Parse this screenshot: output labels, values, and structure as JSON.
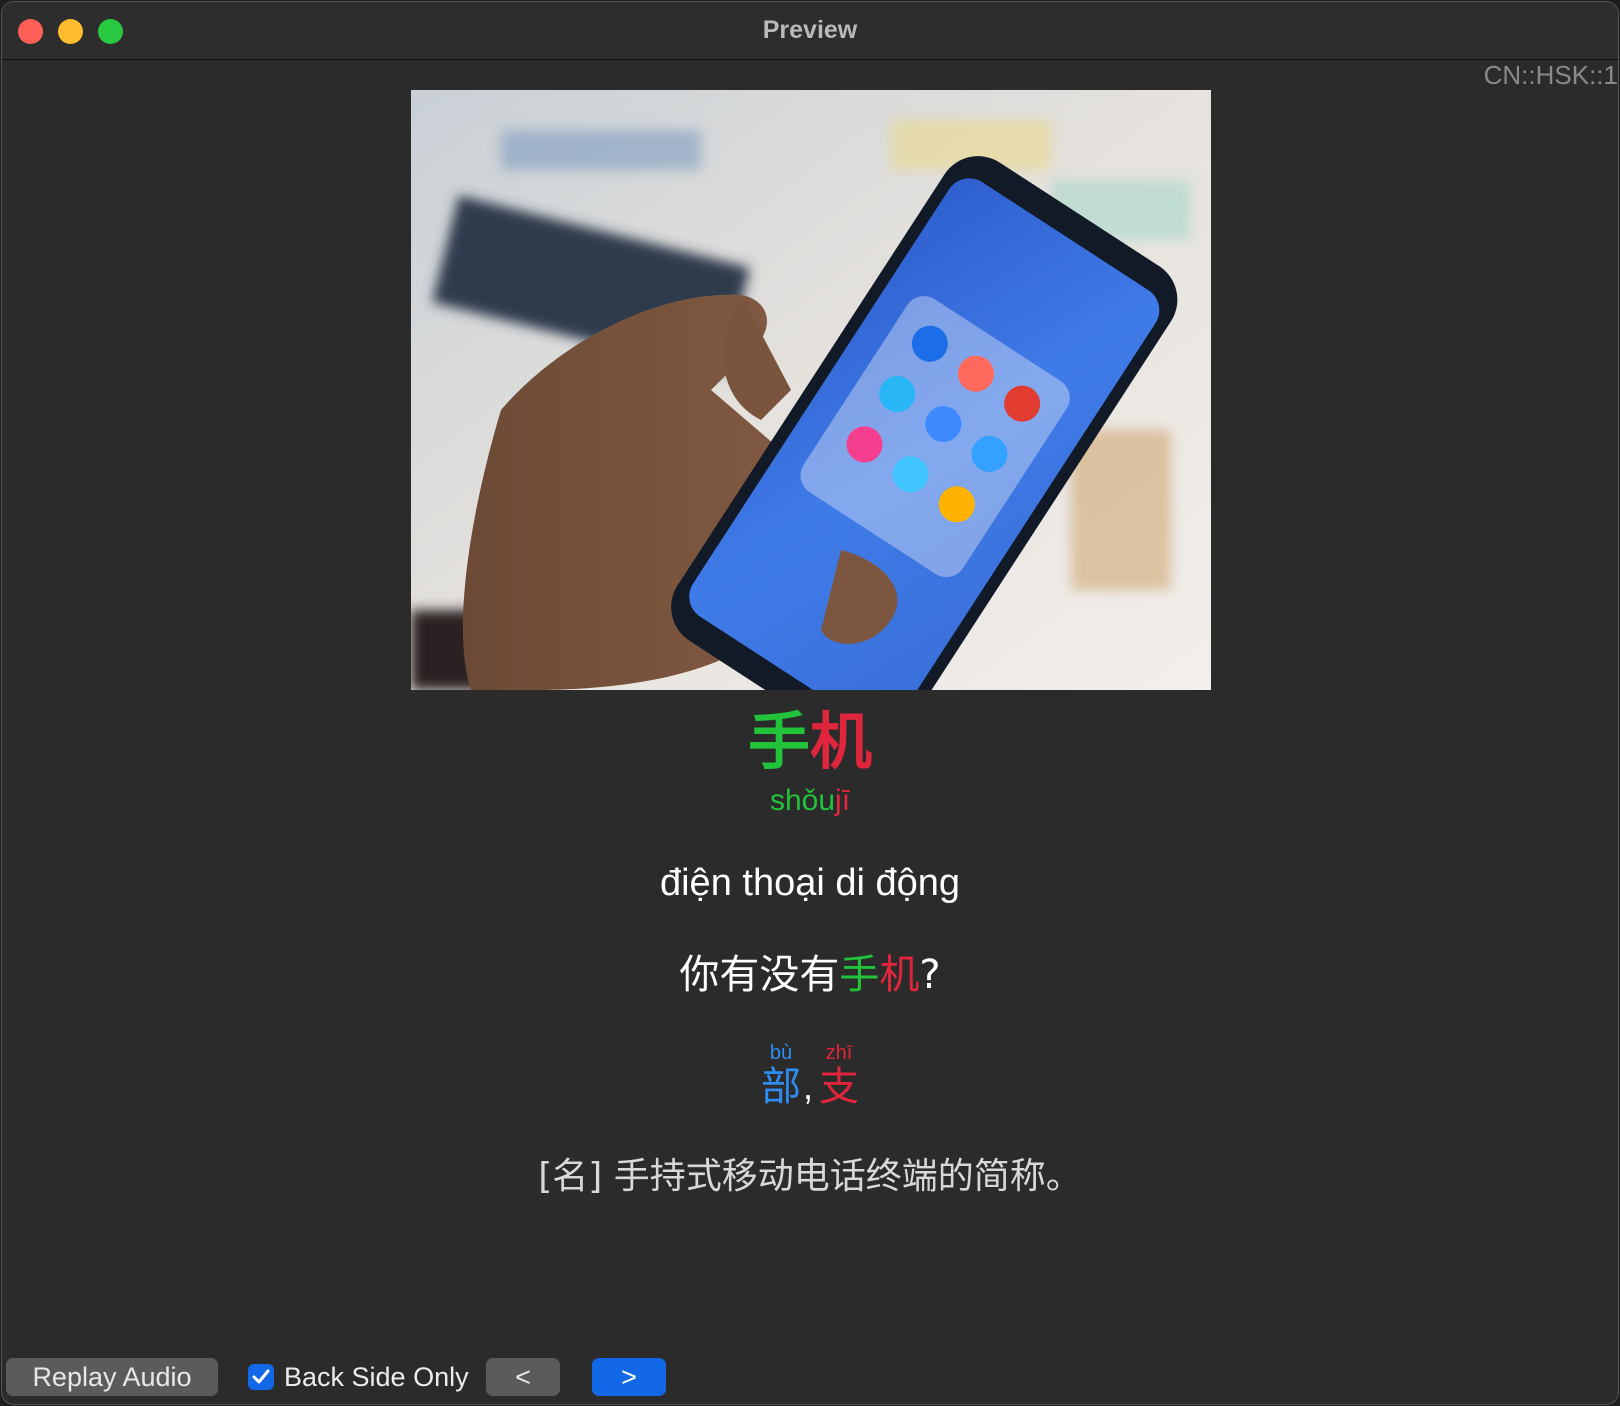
{
  "window": {
    "title": "Preview",
    "deck_tag": "CN::HSK::1"
  },
  "card": {
    "image_alt": "hand holding smartphone",
    "hanzi": [
      {
        "char": "手",
        "tone_color": "#22c23a"
      },
      {
        "char": "机",
        "tone_color": "#e0263c"
      }
    ],
    "pinyin": [
      {
        "syllable": "shǒu",
        "tone_color": "#22c23a"
      },
      {
        "syllable": "jī",
        "tone_color": "#e0263c"
      }
    ],
    "meaning": "điện thoại di động",
    "example": {
      "prefix": "你有没有",
      "word_1": "手",
      "word_2": "机",
      "suffix": "?"
    },
    "classifiers": [
      {
        "pinyin": "bù",
        "hanzi": "部",
        "tone_color": "#2f8cf0"
      },
      {
        "pinyin": "zhī",
        "hanzi": "支",
        "tone_color": "#e0263c"
      }
    ],
    "classifier_separator": ",",
    "definition": "[名] 手持式移动电话终端的简称。"
  },
  "controls": {
    "replay_label": "Replay Audio",
    "back_side_only_label": "Back Side Only",
    "back_side_only_checked": true,
    "prev_label": "<",
    "next_label": ">"
  }
}
